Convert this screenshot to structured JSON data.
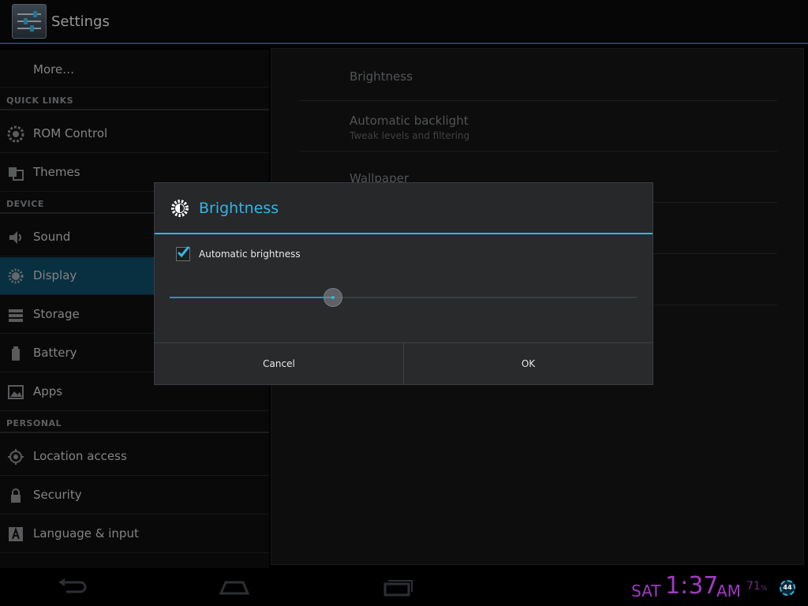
{
  "app": {
    "title": "Settings"
  },
  "sidebar": {
    "items": [
      {
        "label": "More…"
      },
      {
        "label": "ROM Control"
      },
      {
        "label": "Themes"
      },
      {
        "label": "Sound"
      },
      {
        "label": "Display"
      },
      {
        "label": "Storage"
      },
      {
        "label": "Battery"
      },
      {
        "label": "Apps"
      },
      {
        "label": "Location access"
      },
      {
        "label": "Security"
      },
      {
        "label": "Language & input"
      }
    ],
    "sections": {
      "quick_links": "QUICK LINKS",
      "device": "DEVICE",
      "personal": "PERSONAL"
    },
    "active_item": "Display"
  },
  "panel": {
    "prefs": [
      {
        "title": "Brightness"
      },
      {
        "title": "Automatic backlight",
        "summary": "Tweak levels and filtering"
      },
      {
        "title": "Wallpaper"
      }
    ]
  },
  "dialog": {
    "title": "Brightness",
    "checkbox_label": "Automatic brightness",
    "checkbox_checked": true,
    "brightness_level": 0.35,
    "cancel_label": "Cancel",
    "ok_label": "OK"
  },
  "status": {
    "day": "SAT",
    "time": "1:37",
    "ampm": "AM",
    "battery": "71",
    "battery_unit": "%",
    "badge": "44"
  },
  "colors": {
    "accent": "#33b5e5",
    "active_item_bg": "#0e4a64",
    "clock": "#a03bbf"
  }
}
